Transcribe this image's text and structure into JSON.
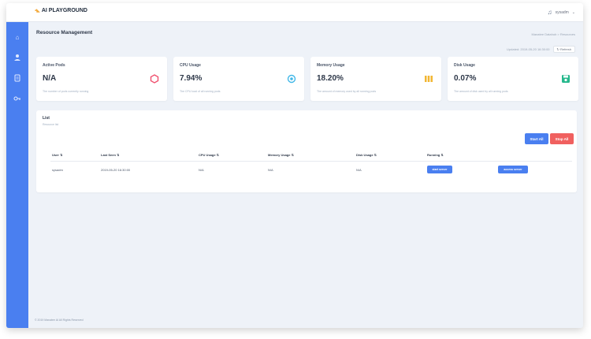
{
  "app": {
    "brand": "AI PLAYGROUND",
    "brand_icon": "logo-icon"
  },
  "topbar": {
    "user": "sysadm"
  },
  "sidebar": {
    "items": [
      "home-icon",
      "user-icon",
      "document-icon",
      "key-icon"
    ]
  },
  "page": {
    "title": "Resource Management",
    "breadcrumb": "Manatee Datahub  >  Resources",
    "updated": "Updated: 2019-05-20 16:30:00",
    "refresh_label": "↻ Refresh"
  },
  "stats": [
    {
      "label": "Active Pods",
      "value": "N/A",
      "desc": "The number of pods currently running",
      "icon": "hexagon-icon",
      "color": "#f0506e"
    },
    {
      "label": "CPU Usage",
      "value": "7.94%",
      "desc": "The CPU load of all running pods",
      "icon": "cpu-icon",
      "color": "#42b8e8"
    },
    {
      "label": "Memory Usage",
      "value": "18.20%",
      "desc": "The amount of memory used by all running pods",
      "icon": "memory-icon",
      "color": "#f2b632"
    },
    {
      "label": "Disk Usage",
      "value": "0.07%",
      "desc": "The amount of disk used by all running pods",
      "icon": "disk-icon",
      "color": "#26b88c"
    }
  ],
  "list": {
    "title": "List",
    "subtitle": "Resource list",
    "start_all": "Start All",
    "stop_all": "Stop All",
    "columns": [
      "User ⇅",
      "Last Seen ⇅",
      "CPU Usage ⇅",
      "Memory Usage ⇅",
      "Disk Usage ⇅",
      "Running ⇅"
    ],
    "rows": [
      {
        "user": "sysadm",
        "last_seen": "2019-05-20 16:30:00",
        "cpu": "N/A",
        "memory": "N/A",
        "disk": "N/A",
        "start_label": "start server",
        "access_label": "access server"
      }
    ]
  },
  "footer": {
    "text": "© 2019 Manatee AI All Rights Reserved"
  }
}
